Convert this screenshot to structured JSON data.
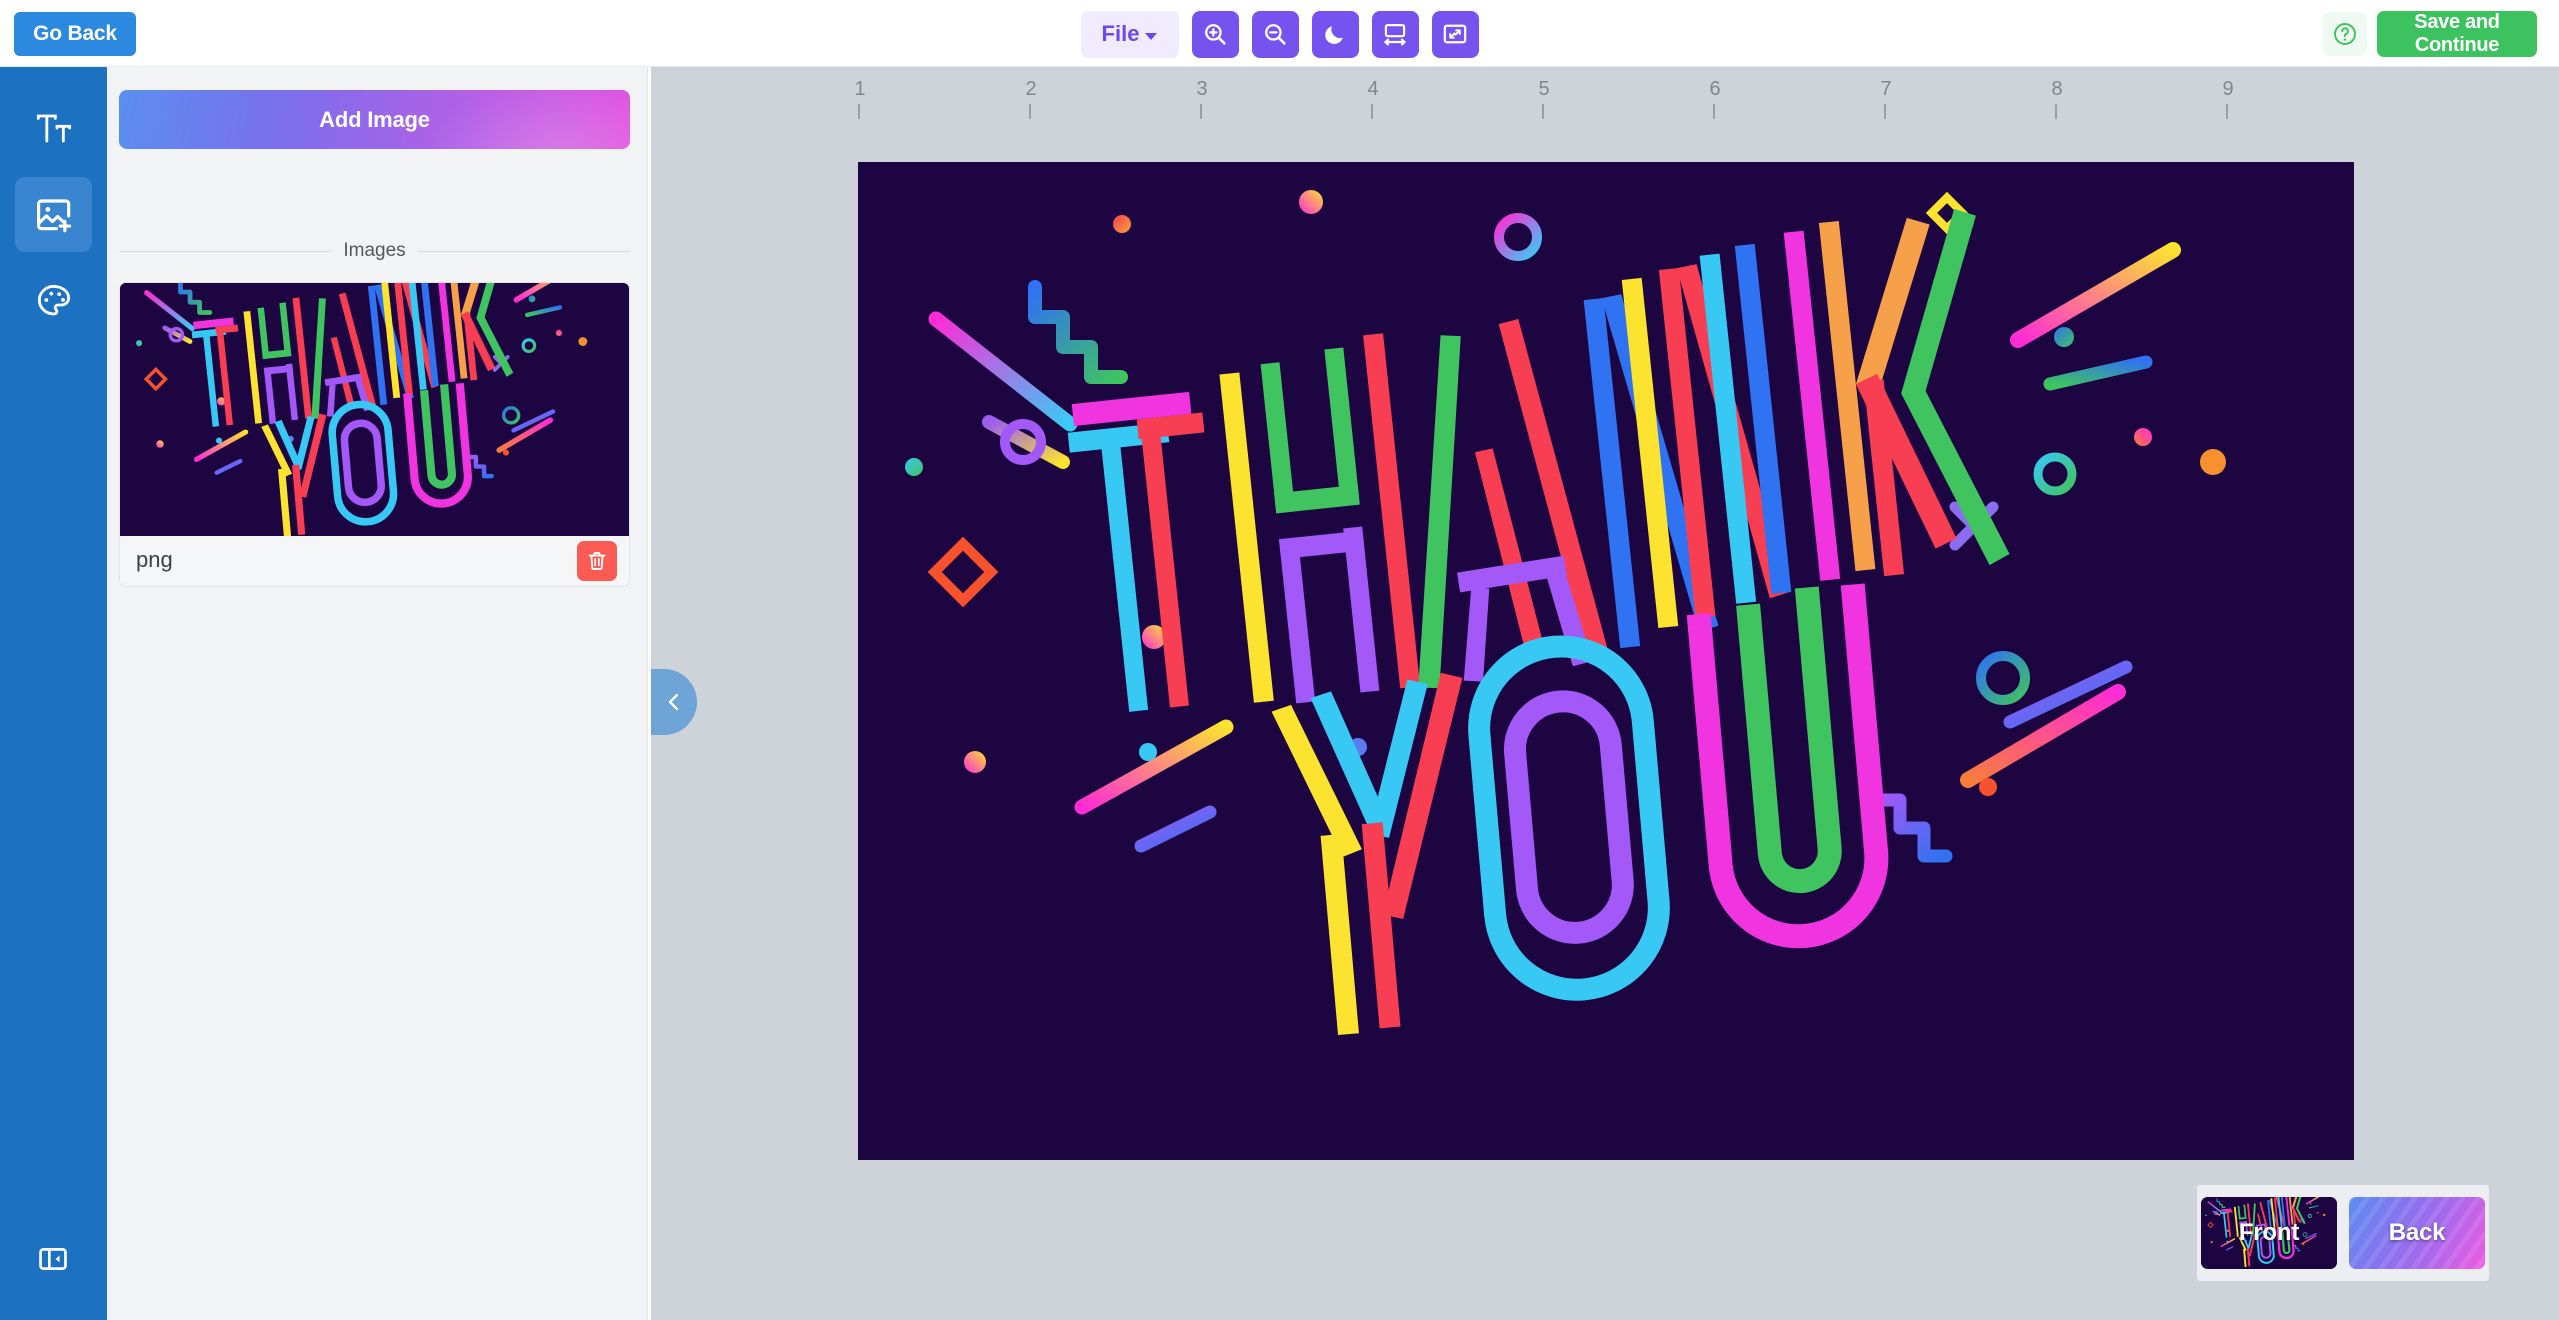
{
  "header": {
    "go_back_label": "Go Back",
    "file_menu_label": "File",
    "tools": [
      {
        "name": "zoom-in-icon",
        "title": "Zoom In"
      },
      {
        "name": "zoom-out-icon",
        "title": "Zoom Out"
      },
      {
        "name": "dark-mode-icon",
        "title": "Dark Mode"
      },
      {
        "name": "fit-width-icon",
        "title": "Fit Width"
      },
      {
        "name": "fit-screen-icon",
        "title": "Fit Screen"
      }
    ],
    "help_label": "?",
    "save_label": "Save and Continue",
    "accent_blue": "#2b8ae0",
    "accent_purple": "#7653ef",
    "accent_green": "#3cc35f"
  },
  "rail": {
    "items": [
      {
        "icon": "text-tool-icon",
        "label": "Text",
        "active": false
      },
      {
        "icon": "image-add-icon",
        "label": "Images",
        "active": true
      },
      {
        "icon": "palette-icon",
        "label": "Colors",
        "active": false
      }
    ],
    "collapse_icon": "sidebar-collapse-icon",
    "background": "#1c71c0"
  },
  "panel": {
    "add_image_label": "Add Image",
    "section_label": "Images",
    "items": [
      {
        "filename": "png",
        "delete_icon": "trash-icon"
      }
    ],
    "delete_color": "#fb5b52"
  },
  "stage": {
    "ruler_ticks": [
      "1",
      "2",
      "3",
      "4",
      "5",
      "6",
      "7",
      "8",
      "9"
    ],
    "toggle_icon": "chevron-left-icon",
    "artboard_background": "#1d0542"
  },
  "artwork": {
    "line1": "THANK",
    "line2": "YOU",
    "palette": {
      "magenta": "#ef34e0",
      "cyan": "#38c8f4",
      "red": "#f73e52",
      "yellow": "#fbe330",
      "green": "#3fc45f",
      "purple": "#a259f7",
      "blue": "#2f72f2",
      "orange": "#f79646"
    }
  },
  "side_selector": {
    "options": [
      {
        "label": "Front",
        "selected": true
      },
      {
        "label": "Back",
        "selected": false
      }
    ],
    "selected_outline": "#48a2e8"
  }
}
